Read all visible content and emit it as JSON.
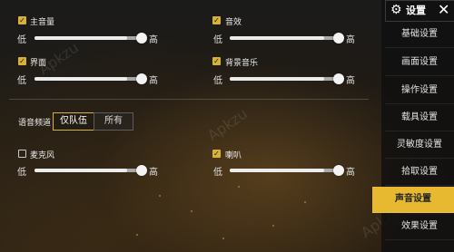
{
  "settings_top": [
    {
      "label": "主音量",
      "checked": true,
      "low": "低",
      "high": "高",
      "value": 0.85
    },
    {
      "label": "音效",
      "checked": true,
      "low": "低",
      "high": "高",
      "value": 0.85
    },
    {
      "label": "界面",
      "checked": true,
      "low": "低",
      "high": "高",
      "value": 0.85
    },
    {
      "label": "背景音乐",
      "checked": true,
      "low": "低",
      "high": "高",
      "value": 0.85
    }
  ],
  "voice_channel": {
    "label": "语音频道",
    "options": [
      "仅队伍",
      "所有"
    ],
    "selected": "仅队伍"
  },
  "settings_bottom": [
    {
      "label": "麦克风",
      "checked": false,
      "low": "低",
      "high": "高",
      "value": 0.85
    },
    {
      "label": "喇叭",
      "checked": true,
      "low": "低",
      "high": "高",
      "value": 0.85
    }
  ],
  "nav": {
    "title": "设置",
    "close": "✕",
    "items": [
      "基础设置",
      "画面设置",
      "操作设置",
      "载具设置",
      "灵敏度设置",
      "拾取设置",
      "声音设置",
      "效果设置"
    ],
    "active": "声音设置"
  },
  "watermark": "Apkzu",
  "colors": {
    "accent": "#e6b931",
    "track": "#a9a9a9",
    "knob": "#f3f3f3"
  }
}
